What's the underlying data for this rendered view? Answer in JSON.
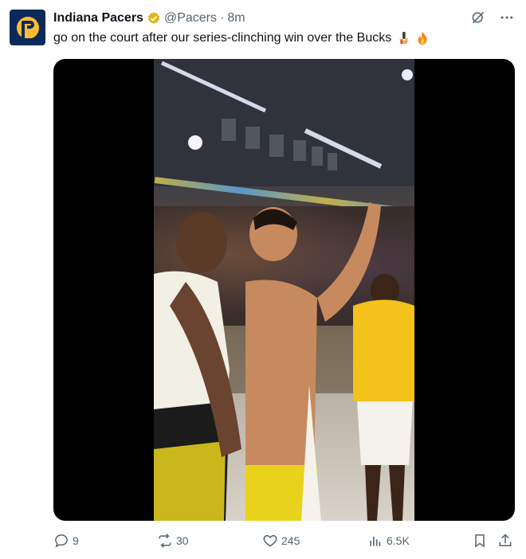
{
  "tweet": {
    "author_name": "Indiana Pacers",
    "handle": "@Pacers",
    "separator": "·",
    "time": "8m",
    "text": "go on the court after our series-clinching win over the Bucks",
    "emojis": [
      "microphone-hand-emoji",
      "fire-emoji"
    ]
  },
  "media": {
    "type": "video",
    "description_icon": "video-icon"
  },
  "actions": {
    "replies": "9",
    "reposts": "30",
    "likes": "245",
    "views": "6.5K"
  },
  "icons": {
    "verified": "verified-badge-icon",
    "grok": "grok-icon",
    "more": "more-icon",
    "reply": "reply-icon",
    "repost": "repost-icon",
    "like": "like-icon",
    "views": "views-icon",
    "bookmark": "bookmark-icon",
    "share": "share-icon"
  },
  "colors": {
    "brand_navy": "#0b2a5b",
    "brand_gold": "#fdbb30",
    "verified_gold": "#e2b719",
    "muted_text": "#536471"
  }
}
